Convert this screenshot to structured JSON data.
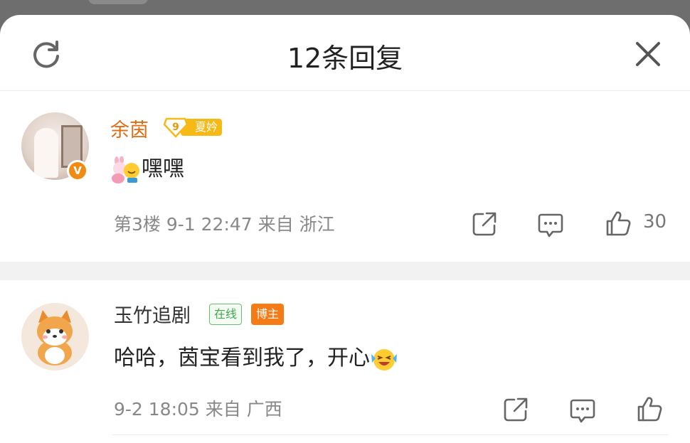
{
  "header": {
    "title": "12条回复"
  },
  "comments": [
    {
      "name": "余茵",
      "level": "9",
      "level_tag": "夏妗",
      "verified_mark": "V",
      "text": "嘿嘿",
      "floor": "第3楼",
      "time": "9-1 22:47",
      "location": "来自 浙江",
      "likes": "30"
    },
    {
      "name": "玉竹追剧",
      "online_badge": "在线",
      "role_badge": "博主",
      "text": "哈哈，茵宝看到我了，开心",
      "time": "9-2 18:05",
      "location": "来自 广西"
    }
  ],
  "icons": {
    "refresh": "refresh-icon",
    "close": "close-icon",
    "share": "share-icon",
    "comment": "comment-icon",
    "like": "thumb-up-icon"
  },
  "colors": {
    "name_highlight": "#e06d14",
    "verified": "#f08a12",
    "level_tag": "#f7b916",
    "online": "#43a64f",
    "blogger": "#f47b16"
  }
}
